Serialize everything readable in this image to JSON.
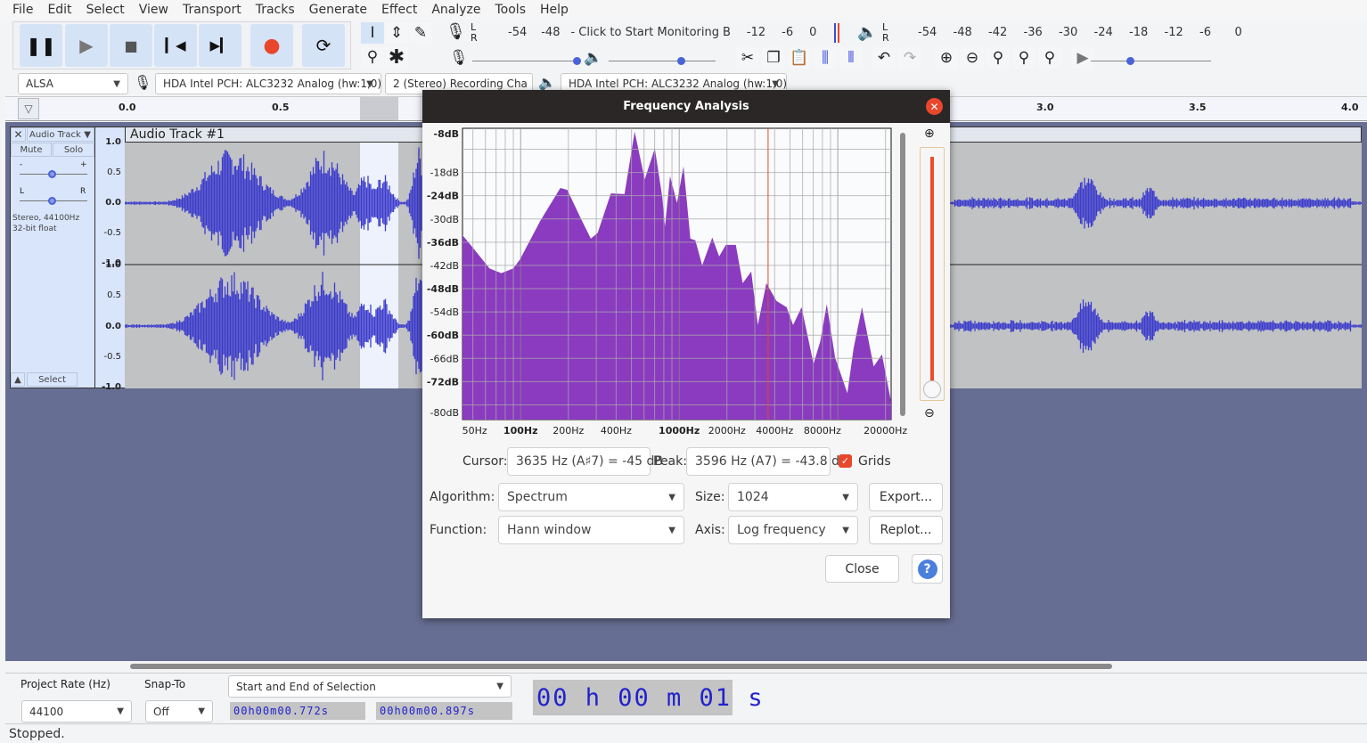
{
  "menu": [
    "File",
    "Edit",
    "Select",
    "View",
    "Transport",
    "Tracks",
    "Generate",
    "Effect",
    "Analyze",
    "Tools",
    "Help"
  ],
  "transport": {
    "pause": "pause-icon",
    "play": "play-icon",
    "stop": "stop-icon",
    "skip_start": "skip-start-icon",
    "skip_end": "skip-end-icon",
    "record": "record-icon",
    "loop": "loop-icon",
    "record_color": "#e8472b"
  },
  "record_meter": {
    "lr": [
      "L",
      "R"
    ],
    "ticks": [
      "-54",
      "-48"
    ],
    "prompt": "- Click to Start Monitoring",
    "ticks2": [
      "B",
      "-12",
      "-6",
      "0"
    ]
  },
  "play_meter": {
    "lr": [
      "L",
      "R"
    ],
    "ticks": [
      "-54",
      "-48",
      "-42",
      "-36",
      "-30",
      "-24",
      "-18",
      "-12",
      "-6",
      "0"
    ]
  },
  "sliders": {
    "minus": "-",
    "plus": "+"
  },
  "devices": {
    "host": "ALSA",
    "rec_device": "HDA Intel PCH: ALC3232 Analog (hw:1,0)",
    "channels": "2 (Stereo) Recording Cha",
    "play_device": "HDA Intel PCH: ALC3232 Analog (hw:1,0)"
  },
  "ruler": {
    "ticks_left": [
      "0.0",
      "0.5"
    ],
    "ticks_right": [
      "3.0",
      "3.5",
      "4.0"
    ]
  },
  "track": {
    "name_menu": "Audio Track",
    "title": "Audio Track #1",
    "mute": "Mute",
    "solo": "Solo",
    "gain_minus": "-",
    "gain_plus": "+",
    "pan_l": "L",
    "pan_r": "R",
    "info1": "Stereo, 44100Hz",
    "info2": "32-bit float",
    "select": "Select",
    "scale": [
      "1.0",
      "0.5",
      "0.0",
      "-0.5",
      "-1.0"
    ],
    "wave_color": "#3c3ccc"
  },
  "dialog": {
    "title": "Frequency Analysis",
    "cursor_label": "Cursor:",
    "cursor_value": "3635 Hz (A♯7) = -45 dB",
    "peak_label": "Peak:",
    "peak_value": "3596 Hz (A7) = -43.8 dB",
    "grids_label": "Grids",
    "grids_checked": true,
    "algorithm_label": "Algorithm:",
    "algorithm": "Spectrum",
    "size_label": "Size:",
    "size": "1024",
    "function_label": "Function:",
    "function": "Hann window",
    "axis_label": "Axis:",
    "axis": "Log frequency",
    "export": "Export...",
    "replot": "Replot...",
    "close": "Close",
    "help": "?"
  },
  "chart_data": {
    "type": "area",
    "x_scale": "log",
    "xlim": [
      43,
      21700
    ],
    "ylim": [
      -81.8,
      -6.6
    ],
    "x_ticks": [
      "50Hz",
      "100Hz",
      "200Hz",
      "400Hz",
      "1000Hz",
      "2000Hz",
      "4000Hz",
      "8000Hz",
      "20000Hz"
    ],
    "x_tick_values": [
      50,
      100,
      200,
      400,
      1000,
      2000,
      4000,
      8000,
      20000
    ],
    "y_ticks": [
      "-8dB",
      "-18dB",
      "-24dB",
      "-30dB",
      "-36dB",
      "-42dB",
      "-48dB",
      "-54dB",
      "-60dB",
      "-66dB",
      "-72dB",
      "-80dB"
    ],
    "y_tick_values": [
      -8,
      -18,
      -24,
      -30,
      -36,
      -42,
      -48,
      -54,
      -60,
      -66,
      -72,
      -80
    ],
    "grid": true,
    "fill_color": "#8a3bbf",
    "cursor_hz": 3635,
    "cursor_color": "#e8472b",
    "points": [
      [
        42.6,
        -34.2
      ],
      [
        49.9,
        -37.4
      ],
      [
        63.7,
        -42.8
      ],
      [
        75.6,
        -44
      ],
      [
        89.8,
        -42.8
      ],
      [
        99,
        -40.5
      ],
      [
        133,
        -30.5
      ],
      [
        178,
        -22
      ],
      [
        197,
        -22.5
      ],
      [
        239,
        -29.8
      ],
      [
        277,
        -35.1
      ],
      [
        306,
        -33.6
      ],
      [
        371,
        -23.4
      ],
      [
        452,
        -23.6
      ],
      [
        524,
        -7.5
      ],
      [
        606,
        -19.8
      ],
      [
        702,
        -11.8
      ],
      [
        782,
        -24.4
      ],
      [
        813,
        -32
      ],
      [
        876,
        -19
      ],
      [
        968,
        -25.9
      ],
      [
        1065,
        -16.4
      ],
      [
        1176,
        -35.1
      ],
      [
        1265,
        -35.5
      ],
      [
        1396,
        -42
      ],
      [
        1616,
        -34.8
      ],
      [
        1785,
        -39.7
      ],
      [
        1968,
        -36.7
      ],
      [
        2276,
        -36.7
      ],
      [
        2514,
        -46.6
      ],
      [
        2846,
        -43.6
      ],
      [
        3130,
        -57.4
      ],
      [
        3545,
        -46.6
      ],
      [
        4112,
        -51.2
      ],
      [
        4757,
        -52.8
      ],
      [
        5228,
        -57.4
      ],
      [
        5914,
        -52.8
      ],
      [
        7030,
        -67.4
      ],
      [
        7753,
        -61.6
      ],
      [
        8530,
        -52
      ],
      [
        9620,
        -65.8
      ],
      [
        11500,
        -75
      ],
      [
        12570,
        -63.5
      ],
      [
        14220,
        -52.8
      ],
      [
        16830,
        -68.1
      ],
      [
        19000,
        -65
      ],
      [
        21740,
        -77.3
      ]
    ]
  },
  "selection_bar": {
    "rate_label": "Project Rate (Hz)",
    "rate": "44100",
    "snap_label": "Snap-To",
    "snap": "Off",
    "mode": "Start and End of Selection",
    "start": "00h00m00.772s",
    "end": "00h00m00.897s",
    "position": "00 h 00 m 01 s"
  },
  "status": "Stopped."
}
